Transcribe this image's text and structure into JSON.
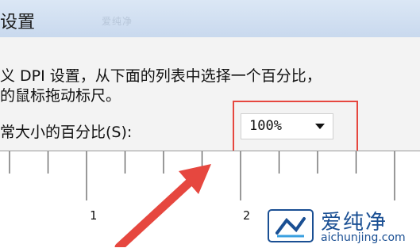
{
  "window": {
    "title": "设置"
  },
  "description": {
    "line1": "义 DPI 设置，从下面的列表中选择一个百分比，",
    "line2": "的鼠标拖动标尺。"
  },
  "scale": {
    "label": "常大小的百分比(S):",
    "selected_value": "100%"
  },
  "ruler": {
    "numbers": [
      "1",
      "2"
    ]
  },
  "watermark": {
    "name": "爱纯净",
    "url": "aichunjing.com",
    "faint_text": "爱纯净"
  },
  "colors": {
    "highlight": "#e6473f",
    "brand": "#1a4f93"
  }
}
